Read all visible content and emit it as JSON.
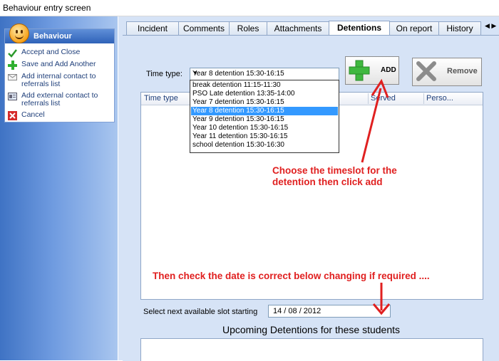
{
  "window": {
    "title": "Behaviour entry screen"
  },
  "sidebar": {
    "title": "Behaviour",
    "actions": [
      {
        "label": "Accept and Close",
        "icon": "checkmark-icon"
      },
      {
        "label": "Save and Add Another",
        "icon": "plus-icon"
      },
      {
        "label": "Add internal contact to referrals list",
        "icon": "envelope-icon"
      },
      {
        "label": "Add external contact to referrals list",
        "icon": "contact-card-icon"
      },
      {
        "label": "Cancel",
        "icon": "close-icon"
      }
    ]
  },
  "tabs": [
    {
      "label": "Incident"
    },
    {
      "label": "Comments"
    },
    {
      "label": "Roles"
    },
    {
      "label": "Attachments"
    },
    {
      "label": "Detentions",
      "active": true
    },
    {
      "label": "On report"
    },
    {
      "label": "History"
    }
  ],
  "time_type": {
    "label": "Time type:",
    "selected": "Year 8 detention 15:30-16:15",
    "options": [
      "break detention 11:15-11:30",
      "PSO Late detention 13:35-14:00",
      "Year 7 detention 15:30-16:15",
      "Year 8 detention 15:30-16:15",
      "Year 9 detention 15:30-16:15",
      "Year 10 detention 15:30-16:15",
      "Year 11 detention 15:30-16:15",
      "school detention 15:30-16:30"
    ]
  },
  "buttons": {
    "add": "ADD",
    "remove": "Remove"
  },
  "grid": {
    "columns": [
      "Time type",
      "Served",
      "Perso..."
    ]
  },
  "next_slot": {
    "label": "Select next available slot starting",
    "date": "14 / 08 / 2012"
  },
  "upcoming": {
    "title": "Upcoming Detentions for these students"
  },
  "annotations": {
    "note1_line1": "Choose the timeslot for the",
    "note1_line2": "detention then click add",
    "note2": "Then check the date is correct below changing if required ...."
  },
  "colors": {
    "annotation": "#e02020",
    "selected_option": "#3399ff",
    "sidebar": "#4a7fd0"
  }
}
